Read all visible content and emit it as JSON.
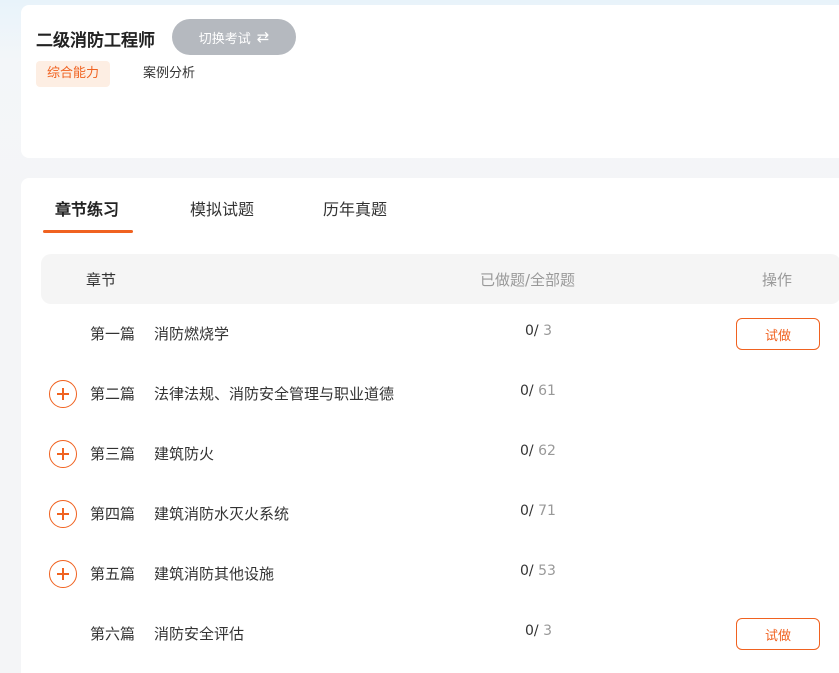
{
  "header": {
    "exam_title": "二级消防工程师",
    "switch_label": "切换考试",
    "switch_icon": "swap-arrows-icon",
    "subjects": [
      {
        "label": "综合能力",
        "active": true
      },
      {
        "label": "案例分析",
        "active": false
      }
    ]
  },
  "tabs": [
    {
      "label": "章节练习",
      "active": true
    },
    {
      "label": "模拟试题",
      "active": false
    },
    {
      "label": "历年真题",
      "active": false
    }
  ],
  "table": {
    "col_chapter": "章节",
    "col_count": "已做题/全部题",
    "col_action": "操作",
    "rows": [
      {
        "no": "第一篇",
        "name": "消防燃烧学",
        "done": "0/",
        "total": "3",
        "expandable": false,
        "action": "试做"
      },
      {
        "no": "第二篇",
        "name": "法律法规、消防安全管理与职业道德",
        "done": "0/",
        "total": "61",
        "expandable": true,
        "action": ""
      },
      {
        "no": "第三篇",
        "name": "建筑防火",
        "done": "0/",
        "total": "62",
        "expandable": true,
        "action": ""
      },
      {
        "no": "第四篇",
        "name": "建筑消防水灭火系统",
        "done": "0/",
        "total": "71",
        "expandable": true,
        "action": ""
      },
      {
        "no": "第五篇",
        "name": "建筑消防其他设施",
        "done": "0/",
        "total": "53",
        "expandable": true,
        "action": ""
      },
      {
        "no": "第六篇",
        "name": "消防安全评估",
        "done": "0/",
        "total": "3",
        "expandable": false,
        "action": "试做"
      }
    ]
  },
  "colors": {
    "accent": "#f06220",
    "switch_bg": "#b5b9bf"
  }
}
